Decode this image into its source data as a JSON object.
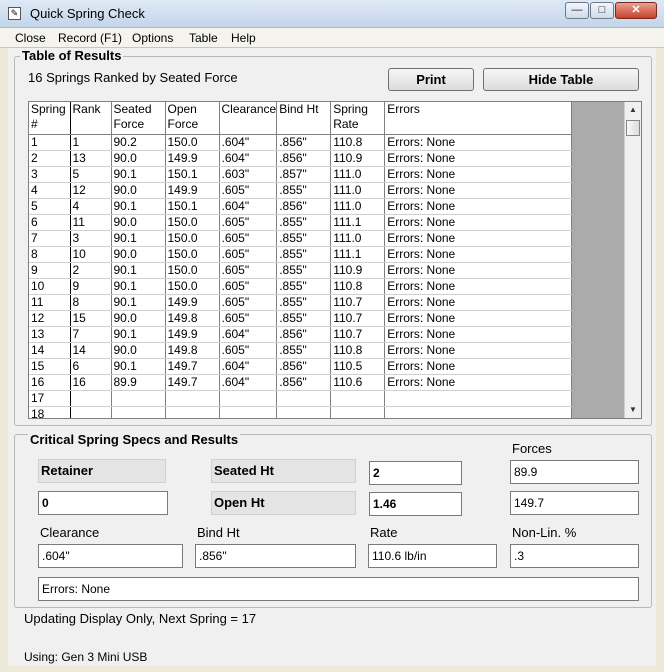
{
  "window": {
    "title": "Quick Spring Check"
  },
  "menu": [
    "Close",
    "Record (F1)",
    "Options",
    "Table",
    "Help"
  ],
  "results": {
    "group_title": "Table of Results",
    "subtitle": "16 Springs Ranked by Seated Force",
    "print_label": "Print",
    "hide_label": "Hide Table",
    "columns": [
      "Spring #",
      "Rank",
      "Seated Force",
      "Open Force",
      "Clearance",
      "Bind Ht",
      "Spring Rate",
      "Errors"
    ],
    "rows": [
      [
        "1",
        "1",
        "90.2",
        "150.0",
        ".604\"",
        ".856\"",
        "110.8",
        "Errors: None"
      ],
      [
        "2",
        "13",
        "90.0",
        "149.9",
        ".604\"",
        ".856\"",
        "110.9",
        "Errors: None"
      ],
      [
        "3",
        "5",
        "90.1",
        "150.1",
        ".603\"",
        ".857\"",
        "111.0",
        "Errors: None"
      ],
      [
        "4",
        "12",
        "90.0",
        "149.9",
        ".605\"",
        ".855\"",
        "111.0",
        "Errors: None"
      ],
      [
        "5",
        "4",
        "90.1",
        "150.1",
        ".604\"",
        ".856\"",
        "111.0",
        "Errors: None"
      ],
      [
        "6",
        "11",
        "90.0",
        "150.0",
        ".605\"",
        ".855\"",
        "111.1",
        "Errors: None"
      ],
      [
        "7",
        "3",
        "90.1",
        "150.0",
        ".605\"",
        ".855\"",
        "111.0",
        "Errors: None"
      ],
      [
        "8",
        "10",
        "90.0",
        "150.0",
        ".605\"",
        ".855\"",
        "111.1",
        "Errors: None"
      ],
      [
        "9",
        "2",
        "90.1",
        "150.0",
        ".605\"",
        ".855\"",
        "110.9",
        "Errors: None"
      ],
      [
        "10",
        "9",
        "90.1",
        "150.0",
        ".605\"",
        ".855\"",
        "110.8",
        "Errors: None"
      ],
      [
        "11",
        "8",
        "90.1",
        "149.9",
        ".605\"",
        ".855\"",
        "110.7",
        "Errors: None"
      ],
      [
        "12",
        "15",
        "90.0",
        "149.8",
        ".605\"",
        ".855\"",
        "110.7",
        "Errors: None"
      ],
      [
        "13",
        "7",
        "90.1",
        "149.9",
        ".604\"",
        ".856\"",
        "110.7",
        "Errors: None"
      ],
      [
        "14",
        "14",
        "90.0",
        "149.8",
        ".605\"",
        ".855\"",
        "110.8",
        "Errors: None"
      ],
      [
        "15",
        "6",
        "90.1",
        "149.7",
        ".604\"",
        ".856\"",
        "110.5",
        "Errors: None"
      ],
      [
        "16",
        "16",
        "89.9",
        "149.7",
        ".604\"",
        ".856\"",
        "110.6",
        "Errors: None"
      ],
      [
        "17",
        "",
        "",
        "",
        "",
        "",
        "",
        ""
      ],
      [
        "18",
        "",
        "",
        "",
        "",
        "",
        "",
        ""
      ]
    ]
  },
  "specs": {
    "group_title": "Critical Spring Specs and Results",
    "retainer_label": "Retainer",
    "retainer_value": "0",
    "seated_ht_label": "Seated Ht",
    "seated_ht_value": "2",
    "open_ht_label": "Open Ht",
    "open_ht_value": "1.46",
    "forces_label": "Forces",
    "force_seated": "89.9",
    "force_open": "149.7",
    "clearance_label": "Clearance",
    "clearance_value": ".604\"",
    "bind_ht_label": "Bind Ht",
    "bind_ht_value": ".856\"",
    "rate_label": "Rate",
    "rate_value": "110.6 lb/in",
    "nonlin_label": "Non-Lin. %",
    "nonlin_value": ".3",
    "errors_value": "Errors: None"
  },
  "status": {
    "updating": "Updating Display Only, Next Spring = 17",
    "using": "Using: Gen 3 Mini USB"
  }
}
